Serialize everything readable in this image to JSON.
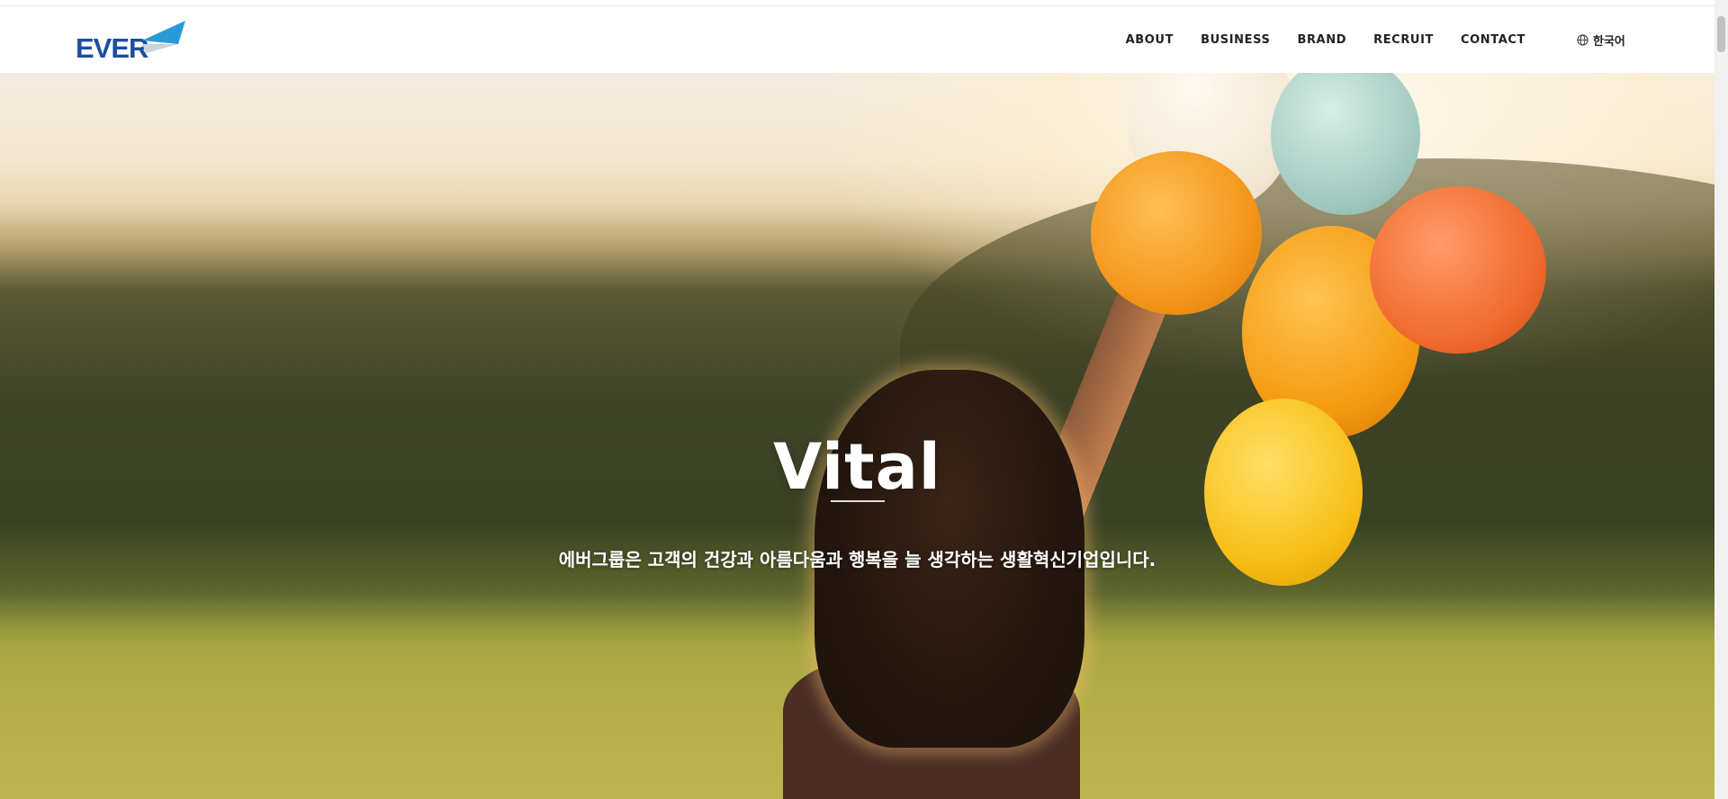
{
  "header": {
    "logo_text": "EVER",
    "nav": [
      {
        "label": "ABOUT"
      },
      {
        "label": "BUSINESS"
      },
      {
        "label": "BRAND"
      },
      {
        "label": "RECRUIT"
      },
      {
        "label": "CONTACT"
      }
    ],
    "language": {
      "label": "한국어",
      "icon": "globe-icon"
    }
  },
  "hero": {
    "title": "Vital",
    "subtitle": "에버그룹은 고객의 건강과 아름다움과 행복을 늘 생각하는 생활혁신기업입니다."
  },
  "colors": {
    "brand_blue": "#1c4fa0",
    "logo_accent": "#2a9ad6",
    "nav_text": "#222222",
    "hero_text": "#ffffff"
  }
}
